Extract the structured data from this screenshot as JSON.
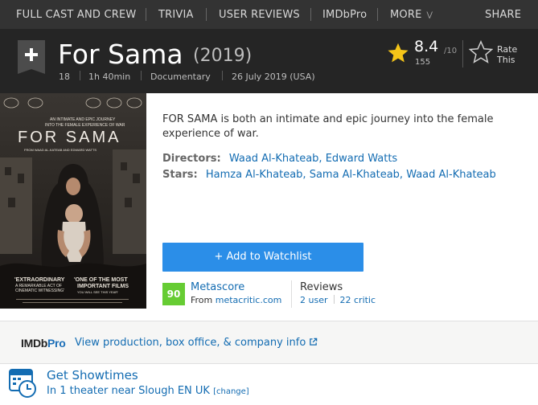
{
  "nav": {
    "items": [
      "FULL CAST AND CREW",
      "TRIVIA",
      "USER REVIEWS",
      "IMDbPro",
      "MORE"
    ],
    "share": "SHARE"
  },
  "title": {
    "name": "For Sama",
    "year": "(2019)",
    "certificate": "18",
    "runtime": "1h 40min",
    "genre": "Documentary",
    "release": "26 July 2019 (USA)"
  },
  "rating": {
    "value": "8.4",
    "best": "/10",
    "count": "155",
    "rate_label_1": "Rate",
    "rate_label_2": "This",
    "star_color": "#f5c518"
  },
  "poster": {
    "top_line_1": "AN INTIMATE AND EPIC JOURNEY",
    "top_line_2": "INTO THE FEMALE EXPERIENCE OF WAR",
    "title": "FOR SAMA",
    "credit_line": "FROM WAAD AL-KATEAB AND EDWARD WATTS",
    "quote_left_1": "'EXTRAORDINARY",
    "quote_left_2": "A REMARKABLE ACT OF",
    "quote_left_3": "CINEMATIC WITNESSING'",
    "quote_right_1": "'ONE OF THE MOST",
    "quote_right_2": "IMPORTANT FILMS",
    "quote_right_3": "YOU WILL SEE THIS YEAR'"
  },
  "plot": "FOR SAMA is both an intimate and epic journey into the female experience of war.",
  "credits": {
    "directors_label": "Directors:",
    "directors": [
      "Waad Al-Khateab",
      "Edward Watts"
    ],
    "stars_label": "Stars:",
    "stars": [
      "Hamza Al-Khateab",
      "Sama Al-Khateab",
      "Waad Al-Khateab"
    ]
  },
  "watchlist": {
    "label": "+  Add to Watchlist",
    "color": "#2b8ee8"
  },
  "metascore": {
    "score": "90",
    "label": "Metascore",
    "from_prefix": "From ",
    "from_link": "metacritic.com",
    "color": "#66cc33"
  },
  "reviews": {
    "label": "Reviews",
    "user": "2 user",
    "critic": "22 critic"
  },
  "imdbpro": {
    "logo_a": "IMDb",
    "logo_b": "Pro",
    "link": "View production, box office, & company info"
  },
  "showtimes": {
    "title": "Get Showtimes",
    "sub": "In 1 theater near Slough EN UK ",
    "change": "[change]"
  }
}
